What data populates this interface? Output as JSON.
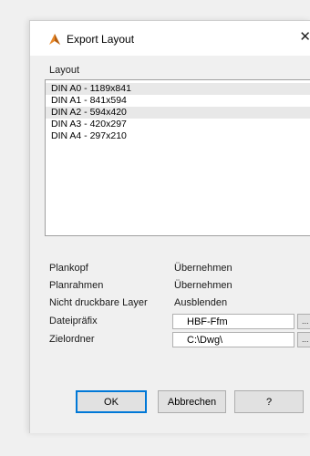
{
  "dialog": {
    "title": "Export Layout",
    "close_glyph": "✕",
    "icon": "autocad-logo-icon"
  },
  "layout": {
    "label": "Layout",
    "items": [
      "DIN A0 - 1189x841",
      "DIN A1 - 841x594",
      "DIN A2 - 594x420",
      "DIN A3 - 420x297",
      "DIN A4 - 297x210"
    ]
  },
  "properties": [
    {
      "label": "Plankopf",
      "value": "Übernehmen",
      "type": "text"
    },
    {
      "label": "Planrahmen",
      "value": "Übernehmen",
      "type": "text"
    },
    {
      "label": "Nicht druckbare Layer",
      "value": "Ausblenden",
      "type": "text"
    },
    {
      "label": "Dateipräfix",
      "value": "HBF-Ffm",
      "type": "input",
      "button": "..."
    },
    {
      "label": "Zielordner",
      "value": "C:\\Dwg\\",
      "type": "input",
      "button": "..."
    }
  ],
  "buttons": {
    "ok": "OK",
    "cancel": "Abbrechen",
    "help": "?"
  },
  "colors": {
    "icon_orange": "#e8892a",
    "icon_dark": "#b55f12",
    "focus_blue": "#0078d7"
  }
}
